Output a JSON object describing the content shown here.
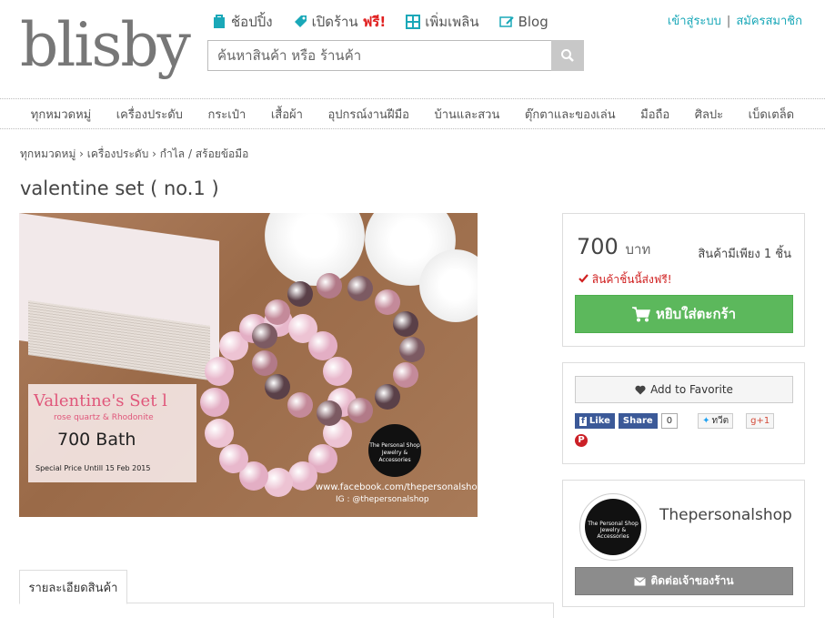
{
  "header": {
    "logo": "blisby",
    "nav": [
      {
        "label": "ช้อปปิ้ง",
        "icon": "shopping-bag-icon"
      },
      {
        "label": "เปิดร้าน",
        "badge": "ฟรี!",
        "icon": "tag-icon"
      },
      {
        "label": "เพิ่มเพลิน",
        "icon": "grid-icon"
      },
      {
        "label": "Blog",
        "icon": "blog-icon"
      }
    ],
    "login": "เข้าสู่ระบบ",
    "separator": "|",
    "register": "สมัครสมาชิก",
    "search_placeholder": "ค้นหาสินค้า หรือ ร้านค้า"
  },
  "categories": [
    "ทุกหมวดหมู่",
    "เครื่องประดับ",
    "กระเป๋า",
    "เสื้อผ้า",
    "อุปกรณ์งานฝีมือ",
    "บ้านและสวน",
    "ตุ๊กตาและของเล่น",
    "มือถือ",
    "ศิลปะ",
    "เบ็ดเตล็ด"
  ],
  "breadcrumb": "ทุกหมวดหมู่ › เครื่องประดับ › กำไล / สร้อยข้อมือ",
  "product": {
    "title": "valentine set ( no.1 )",
    "image_text": {
      "heading": "Valentine's Set l",
      "sub": "rose quartz & Rhodonite",
      "price": "700 Bath",
      "special": "Special  Price Untill 15 Feb 2015",
      "badge_line1": "The Personal Shop",
      "badge_line2": "Jewelry & Accessories",
      "facebook": "www.facebook.com/thepersonalshop",
      "ig": "IG : @thepersonalshop"
    },
    "price": "700",
    "price_unit": "บาท",
    "stock": "สินค้ามีเพียง 1 ชิ้น",
    "free_shipping": "สินค้าชิ้นนี้ส่งฟรี!",
    "cart_button": "หยิบใส่ตะกร้า"
  },
  "social": {
    "favorite": "Add to Favorite",
    "like": "Like",
    "share": "Share",
    "share_count": "0",
    "tweet": "ทวีต",
    "gplus": "+1"
  },
  "shop": {
    "name": "Thepersonalshop",
    "logo_line1": "The Personal Shop",
    "logo_line2": "Jewelry & Accessories",
    "contact": "ติดต่อเจ้าของร้าน"
  },
  "tabs": [
    "รายละเอียดสินค้า"
  ],
  "colors": {
    "accent": "#1aa8b8",
    "cart": "#5cb85c",
    "free": "#e02020",
    "facebook": "#3b5998"
  }
}
